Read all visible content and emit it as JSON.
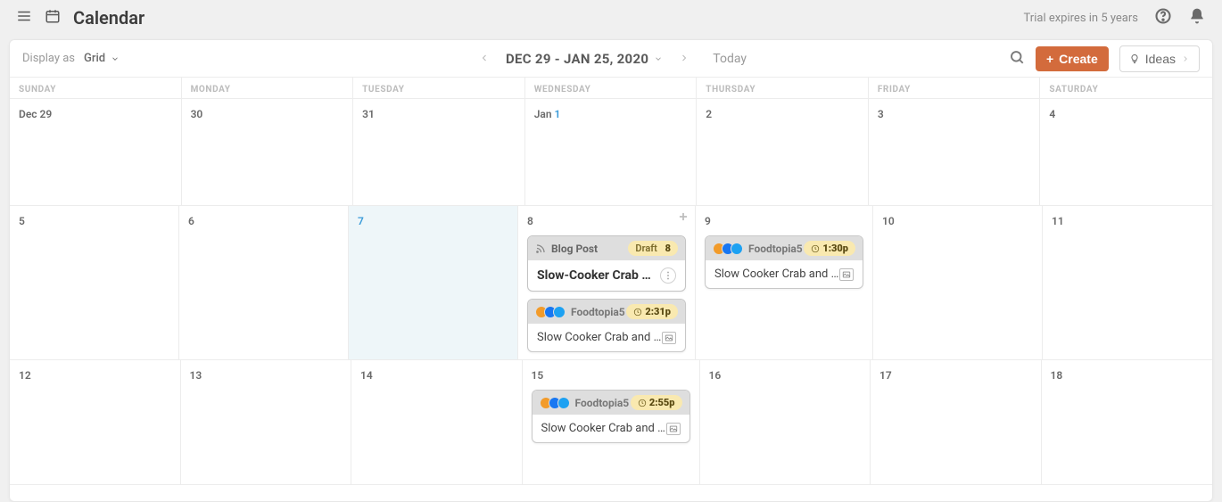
{
  "topbar": {
    "title": "Calendar",
    "trial_text": "Trial expires in 5 years"
  },
  "header": {
    "display_label": "Display as",
    "display_mode": "Grid",
    "date_range": "DEC 29 - JAN 25, 2020",
    "today": "Today",
    "create": "Create",
    "ideas": "Ideas"
  },
  "dow": [
    "SUNDAY",
    "MONDAY",
    "TUESDAY",
    "WEDNESDAY",
    "THURSDAY",
    "FRIDAY",
    "SATURDAY"
  ],
  "rows": [
    {
      "days": [
        {
          "label": "Dec 29",
          "events": []
        },
        {
          "label": "30",
          "events": []
        },
        {
          "label": "31",
          "events": []
        },
        {
          "label_prefix": "Jan ",
          "label_highlight": "1",
          "events": []
        },
        {
          "label": "2",
          "events": []
        },
        {
          "label": "3",
          "events": []
        },
        {
          "label": "4",
          "events": []
        }
      ]
    },
    {
      "days": [
        {
          "label": "5",
          "events": []
        },
        {
          "label": "6",
          "events": []
        },
        {
          "label": "7",
          "today": true,
          "events": []
        },
        {
          "label": "8",
          "show_add": true,
          "events": [
            {
              "type": "blog",
              "type_label": "Blog Post",
              "status": "Draft",
              "status_num": "8",
              "title": "Slow-Cooker Crab Dip"
            },
            {
              "type": "social",
              "profile": "Foodtopia5",
              "time": "2:31p",
              "text": "Slow Cooker Crab and Ar…"
            }
          ]
        },
        {
          "label": "9",
          "events": [
            {
              "type": "social",
              "profile": "Foodtopia5",
              "time": "1:30p",
              "text": "Slow Cooker Crab and Ar…"
            }
          ]
        },
        {
          "label": "10",
          "events": []
        },
        {
          "label": "11",
          "events": []
        }
      ]
    },
    {
      "days": [
        {
          "label": "12",
          "events": []
        },
        {
          "label": "13",
          "events": []
        },
        {
          "label": "14",
          "events": []
        },
        {
          "label": "15",
          "events": [
            {
              "type": "social",
              "profile": "Foodtopia5",
              "time": "2:55p",
              "text": "Slow Cooker Crab and Ar…"
            }
          ]
        },
        {
          "label": "16",
          "events": []
        },
        {
          "label": "17",
          "events": []
        },
        {
          "label": "18",
          "events": []
        }
      ]
    }
  ]
}
